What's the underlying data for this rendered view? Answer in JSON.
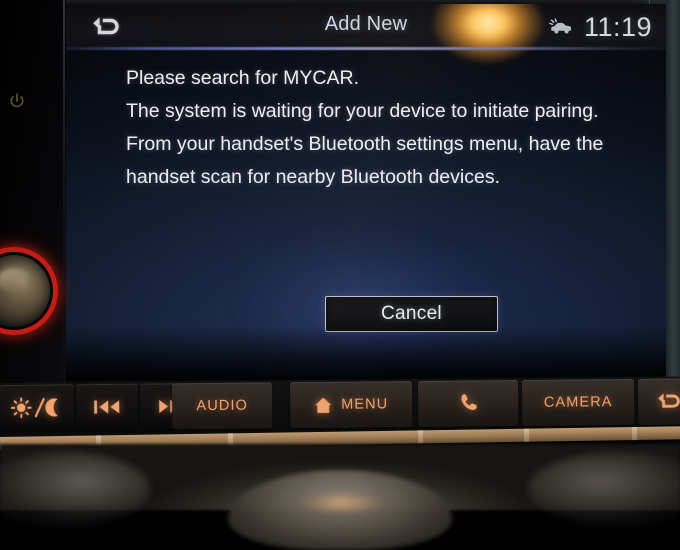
{
  "header": {
    "back_icon": "back-arrow-icon",
    "title": "Add New",
    "status_icon": "car-sensor-icon",
    "clock": "11:19"
  },
  "message": {
    "line1": "Please search for MYCAR.",
    "line2": "The system is waiting for your device to initiate pairing. From your handset's Bluetooth settings menu, have the handset scan for nearby Bluetooth devices."
  },
  "actions": {
    "cancel_label": "Cancel"
  },
  "hard_buttons": [
    {
      "name": "day-night-button",
      "label": "",
      "icon": "sun-moon-icon"
    },
    {
      "name": "track-prev-button",
      "label": "",
      "icon": "prev-track-icon"
    },
    {
      "name": "track-next-button",
      "label": "",
      "icon": "next-track-icon"
    },
    {
      "name": "audio-button",
      "label": "AUDIO",
      "icon": ""
    },
    {
      "name": "menu-button",
      "label": "MENU",
      "icon": "home-icon"
    },
    {
      "name": "phone-button",
      "label": "",
      "icon": "phone-handset-icon"
    },
    {
      "name": "camera-button",
      "label": "CAMERA",
      "icon": ""
    },
    {
      "name": "back-button",
      "label": "",
      "icon": "back-arrow-icon"
    }
  ],
  "hardware": {
    "volume_knob": "volume-knob",
    "power_icon": "power-icon"
  },
  "colors": {
    "amber": "#f0a271",
    "screen_text": "#eceef2",
    "knob_ring": "#d41f18",
    "header_divider": "#7884cd"
  }
}
